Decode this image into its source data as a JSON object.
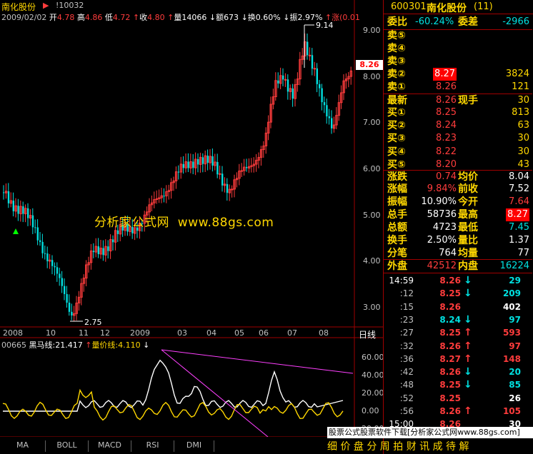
{
  "header": {
    "stock_name": "南化股份",
    "indicator_code": "!10032",
    "date": "2009/02/02",
    "open_label": "开",
    "open_value": "4.78",
    "high_label": "高",
    "high_value": "4.86",
    "low_label": "低",
    "low_value": "4.72",
    "close_label": "收",
    "close_value": "4.80",
    "volume_label": "量",
    "volume_value": "14066",
    "amount_label": "额",
    "amount_value": "673",
    "turnover_label": "换",
    "turnover_value": "0.60%",
    "amplitude_label": "振",
    "amplitude_value": "2.97%",
    "change_label": "涨",
    "change_value": "(0.01"
  },
  "price_axis": [
    "9.00",
    "8.00",
    "7.00",
    "6.00",
    "5.00",
    "4.00",
    "3.00"
  ],
  "price_marker": "8.26",
  "peak_label": "9.14",
  "trough_label": "2.75",
  "watermark": "分析家公式网  www.88gs.com",
  "time_axis": [
    "2008",
    "10",
    "11",
    "12",
    "2009",
    "03",
    "04",
    "05",
    "06",
    "07",
    "08"
  ],
  "daily_label": "日线",
  "indicator": {
    "code": "00665",
    "line1_label": "黑马线:",
    "line1_value": "21.417",
    "line2_label": "量价线:",
    "line2_value": "4.110",
    "axis": [
      "60.00",
      "40.00",
      "20.00",
      "0.00",
      "-20.00"
    ]
  },
  "tabs": [
    "MA",
    "BOLL",
    "MACD",
    "RSI",
    "DMI"
  ],
  "ticker_text_1": "股票公式股票软件下载[分析家公式网www.88gs.com]",
  "ticker_text_2": "细 价 盘 分 周 拍 财 讯 成 待 解",
  "panel": {
    "code": "600301",
    "name": "南化股份",
    "count": "(11)",
    "weibi_label": "委比",
    "weibi_value": "-60.24%",
    "weicha_label": "委差",
    "weicha_value": "-2966",
    "sells": [
      {
        "label": "卖⑤",
        "price": "",
        "vol": ""
      },
      {
        "label": "卖④",
        "price": "",
        "vol": ""
      },
      {
        "label": "卖③",
        "price": "",
        "vol": ""
      },
      {
        "label": "卖②",
        "price": "8.27",
        "vol": "3824"
      },
      {
        "label": "卖①",
        "price": "8.26",
        "vol": "121"
      }
    ],
    "latest_label": "最新",
    "latest_value": "8.26",
    "xianshou_label": "现手",
    "xianshou_value": "30",
    "buys": [
      {
        "label": "买①",
        "price": "8.25",
        "vol": "813"
      },
      {
        "label": "买②",
        "price": "8.24",
        "vol": "63"
      },
      {
        "label": "买③",
        "price": "8.23",
        "vol": "30"
      },
      {
        "label": "买④",
        "price": "8.22",
        "vol": "30"
      },
      {
        "label": "买⑤",
        "price": "8.20",
        "vol": "43"
      }
    ],
    "stats": [
      {
        "l1": "涨跌",
        "v1": "0.74",
        "l2": "均价",
        "v2": "8.04"
      },
      {
        "l1": "涨幅",
        "v1": "9.84%",
        "l2": "前收",
        "v2": "7.52"
      },
      {
        "l1": "振幅",
        "v1": "10.90%",
        "l2": "今开",
        "v2": "7.64"
      },
      {
        "l1": "总手",
        "v1": "58736",
        "l2": "最高",
        "v2": "8.27"
      },
      {
        "l1": "总额",
        "v1": "4723",
        "l2": "最低",
        "v2": "7.45"
      },
      {
        "l1": "换手",
        "v1": "2.50%",
        "l2": "量比",
        "v2": "1.37"
      },
      {
        "l1": "分笔",
        "v1": "764",
        "l2": "均量",
        "v2": "77"
      }
    ],
    "waipan_label": "外盘",
    "waipan_value": "42512",
    "neipan_label": "内盘",
    "neipan_value": "16224",
    "ticks": [
      {
        "t": "14:59",
        "p": "8.26",
        "a": "↓",
        "q": "29"
      },
      {
        "t": ":12",
        "p": "8.25",
        "a": "↓",
        "q": "209"
      },
      {
        "t": ":15",
        "p": "8.26",
        "a": "",
        "q": "402"
      },
      {
        "t": ":23",
        "p": "8.24",
        "a": "↓",
        "q": "97"
      },
      {
        "t": ":27",
        "p": "8.25",
        "a": "↑",
        "q": "593"
      },
      {
        "t": ":32",
        "p": "8.26",
        "a": "↑",
        "q": "97"
      },
      {
        "t": ":36",
        "p": "8.27",
        "a": "↑",
        "q": "148"
      },
      {
        "t": ":42",
        "p": "8.26",
        "a": "↓",
        "q": "20"
      },
      {
        "t": ":48",
        "p": "8.25",
        "a": "↓",
        "q": "85"
      },
      {
        "t": ":52",
        "p": "8.25",
        "a": "",
        "q": "26"
      },
      {
        "t": ":56",
        "p": "8.26",
        "a": "↑",
        "q": "105"
      },
      {
        "t": "15:00",
        "p": "8.26",
        "a": "",
        "q": "30"
      }
    ]
  }
}
